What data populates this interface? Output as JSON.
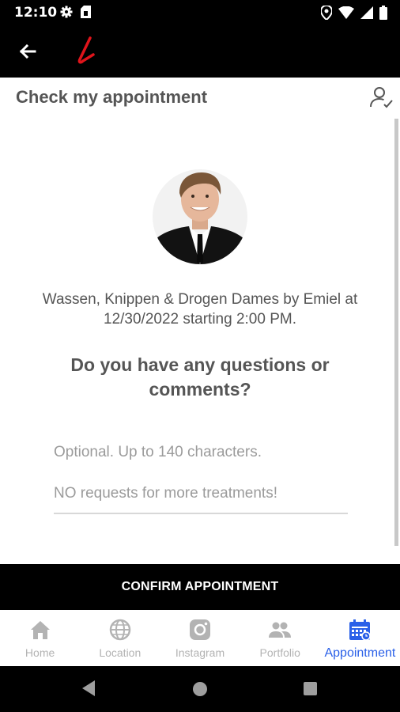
{
  "status_bar": {
    "time": "12:10",
    "left_icons": [
      "gear-icon",
      "sim-card-icon"
    ],
    "right_icons": [
      "location-icon",
      "wifi-icon",
      "signal-icon",
      "battery-icon"
    ]
  },
  "app_bar": {
    "back_icon": "arrow-left-icon",
    "logo_icon": "brand-logo-icon",
    "colors": {
      "background": "#000000",
      "logo": "#e0141b"
    }
  },
  "page": {
    "title": "Check my appointment",
    "account_icon": "account-check-icon"
  },
  "appointment": {
    "description": "Wassen, Knippen & Drogen Dames by Emiel at 12/30/2022 starting 2:00 PM."
  },
  "comments": {
    "question": "Do you have any questions or comments?",
    "placeholder": "Optional. Up to 140 characters.\nNO requests for more treatments!",
    "value": ""
  },
  "confirm_button": {
    "label": "CONFIRM APPOINTMENT"
  },
  "bottom_nav": {
    "items": [
      {
        "label": "Home",
        "icon": "home-icon",
        "active": false
      },
      {
        "label": "Location",
        "icon": "globe-icon",
        "active": false
      },
      {
        "label": "Instagram",
        "icon": "instagram-icon",
        "active": false
      },
      {
        "label": "Portfolio",
        "icon": "people-icon",
        "active": false
      },
      {
        "label": "Appointment",
        "icon": "calendar-icon",
        "active": true
      }
    ],
    "colors": {
      "active": "#2a60e8",
      "inactive": "#b3b3b3"
    }
  },
  "system_nav": {
    "icons": [
      "back-triangle-icon",
      "home-circle-icon",
      "recents-square-icon"
    ]
  }
}
